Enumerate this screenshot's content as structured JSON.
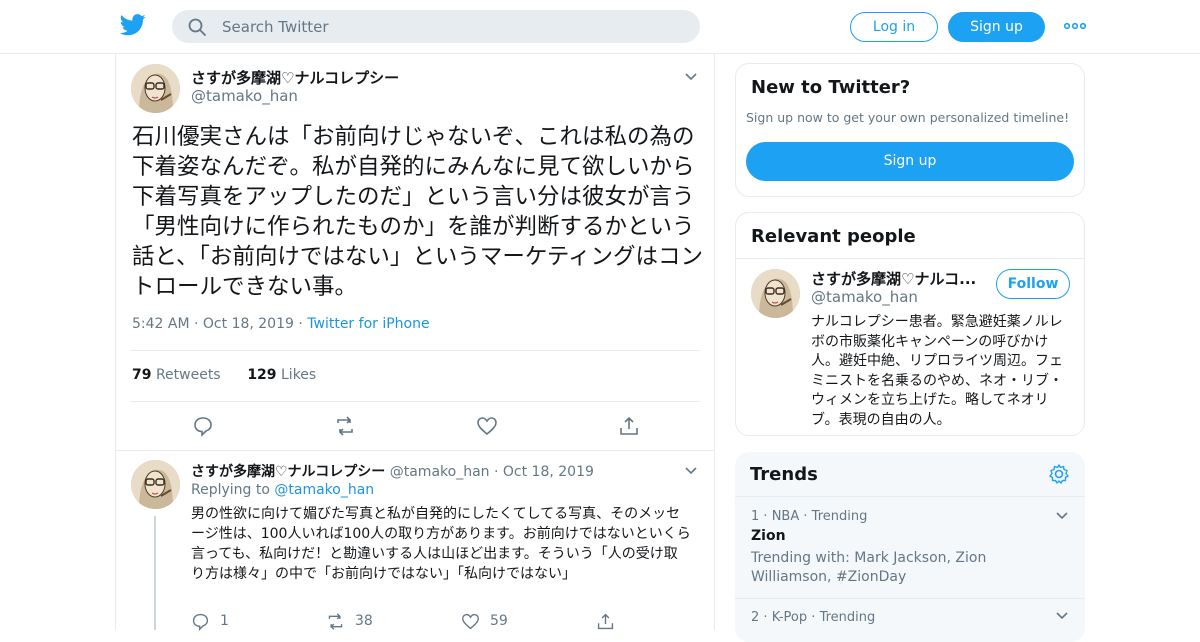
{
  "header": {
    "logo_icon": "twitter-bird-icon",
    "search_placeholder": "Search Twitter",
    "login_label": "Log in",
    "signup_label": "Sign up",
    "more_icon": "ellipsis-icon",
    "brand_color": "#1da1f2"
  },
  "tweet": {
    "display_name": "さすが多摩湖♡ナルコレプシー",
    "handle": "@tamako_han",
    "text": "石川優実さんは「お前向けじゃないぞ、これは私の為の下着姿なんだぞ。私が自発的にみんなに見て欲しいから下着写真をアップしたのだ」という言い分は彼女が言う「男性向けに作られたものか」を誰が判断するかという話と、「お前向けではない」というマーケティングはコントロールできない事。",
    "time": "5:42 AM",
    "sep1": "·",
    "date": "Oct 18, 2019",
    "sep2": "·",
    "source": "Twitter for iPhone",
    "retweets_count": "79",
    "retweets_label": "Retweets",
    "likes_count": "129",
    "likes_label": "Likes"
  },
  "reply": {
    "display_name": "さすが多摩湖♡ナルコレプシー",
    "handle": "@tamako_han",
    "sep": "·",
    "date": "Oct 18, 2019",
    "replying_label": "Replying to",
    "replying_to": "@tamako_han",
    "text": "男の性欲に向けて媚びた写真と私が自発的にしたくてしてる写真、そのメッセージ性は、100人いれば100人の取り方があります。お前向けではないといくら言っても、私向けだ！と勘違いする人は山ほど出ます。そういう「人の受け取り方は様々」の中で「お前向けではない」「私向けではない」",
    "reply_count": "1",
    "retweet_count": "38",
    "like_count": "59"
  },
  "new_to_twitter": {
    "title": "New to Twitter?",
    "subtitle": "Sign up now to get your own personalized timeline!",
    "button": "Sign up"
  },
  "relevant_people": {
    "title": "Relevant people",
    "name": "さすが多摩湖♡ナルコ...",
    "handle": "@tamako_han",
    "follow_label": "Follow",
    "bio": "ナルコレプシー患者。緊急避妊薬ノルレボの市販薬化キャンペーンの呼びかけ人。避妊中絶、リプロライツ周辺。フェミニストを名乗るのやめ、ネオ・リブ・ウィメンを立ち上げた。略してネオリブ。表現の自由の人。"
  },
  "trends": {
    "title": "Trends",
    "settings_icon": "gear-icon",
    "items": [
      {
        "rank": "1",
        "sep": "·",
        "category": "NBA",
        "sep2": "·",
        "status": "Trending",
        "name": "Zion",
        "with": "Trending with: Mark Jackson, Zion Williamson, #ZionDay"
      },
      {
        "rank": "2",
        "sep": "·",
        "category": "K-Pop",
        "sep2": "·",
        "status": "Trending"
      }
    ]
  }
}
